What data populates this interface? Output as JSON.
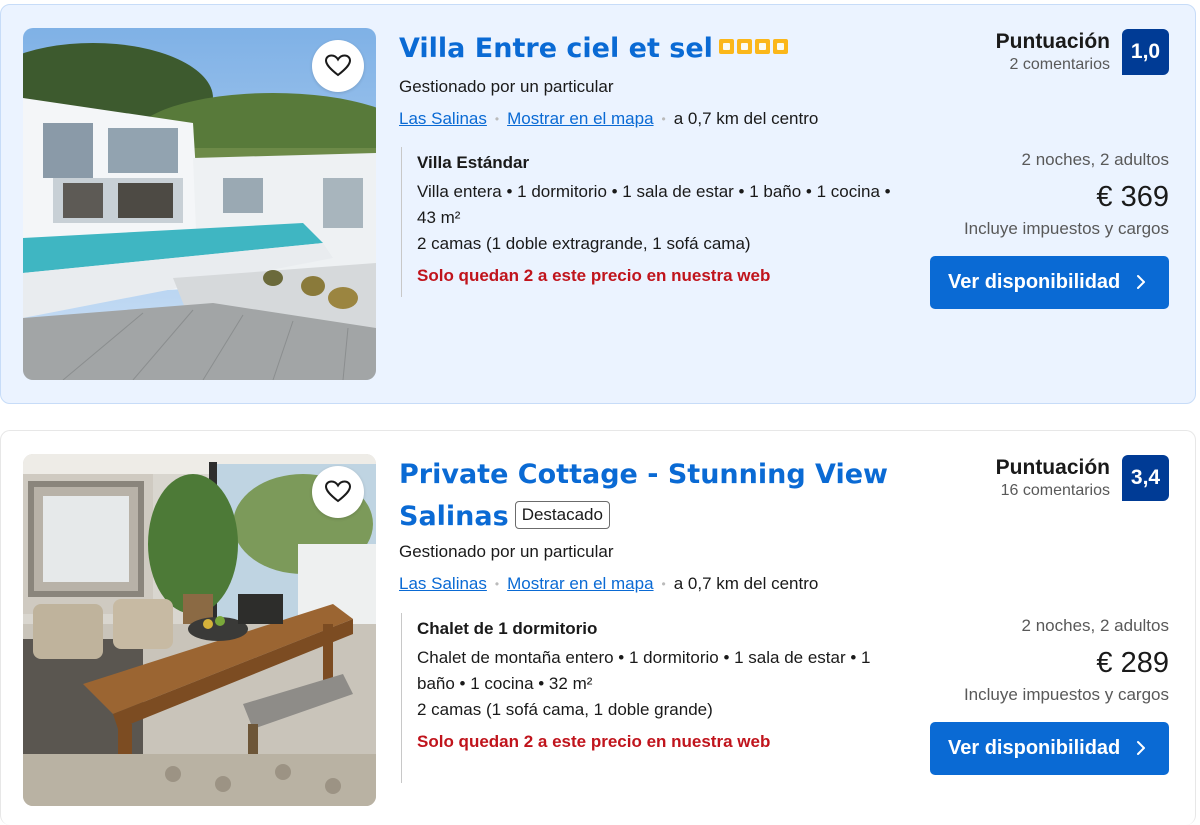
{
  "listings": [
    {
      "title": "Villa Entre ciel et sel",
      "star_count": 4,
      "managed_by": "Gestionado por un particular",
      "location_link": "Las Salinas",
      "map_link": "Mostrar en el mapa",
      "distance": "a 0,7 km del centro",
      "room_name": "Villa Estándar",
      "room_desc": "Villa entera • 1 dormitorio • 1 sala de estar • 1 baño • 1 cocina • 43 m²",
      "beds": "2 camas (1 doble extragrande, 1 sofá cama)",
      "scarcity": "Solo quedan 2 a este precio en nuestra web",
      "score_label": "Puntuación",
      "reviews": "2 comentarios",
      "score": "1,0",
      "stay": "2 noches, 2 adultos",
      "price": "€ 369",
      "taxes": "Incluye impuestos y cargos",
      "cta": "Ver disponibilidad"
    },
    {
      "title_line1": "Private Cottage - Stunning View",
      "title_line2": "Salinas",
      "badge": "Destacado",
      "managed_by": "Gestionado por un particular",
      "location_link": "Las Salinas",
      "map_link": "Mostrar en el mapa",
      "distance": "a 0,7 km del centro",
      "room_name": "Chalet de 1 dormitorio",
      "room_desc": "Chalet de montaña entero • 1 dormitorio • 1 sala de estar • 1 baño • 1 cocina • 32 m²",
      "beds": "2 camas (1 sofá cama, 1 doble grande)",
      "scarcity": "Solo quedan 2 a este precio en nuestra web",
      "score_label": "Puntuación",
      "reviews": "16 comentarios",
      "score": "3,4",
      "stay": "2 noches, 2 adultos",
      "price": "€ 289",
      "taxes": "Incluye impuestos y cargos",
      "cta": "Ver disponibilidad"
    }
  ],
  "icons": {
    "favorite": "heart-outline-icon",
    "cta_arrow": "chevron-right-icon"
  },
  "colors": {
    "link_blue": "#0a6ad4",
    "score_blue": "#003b95",
    "scarcity_red": "#c0141c",
    "star_yellow": "#fbb71a",
    "highlight_bg": "#ebf3ff"
  }
}
